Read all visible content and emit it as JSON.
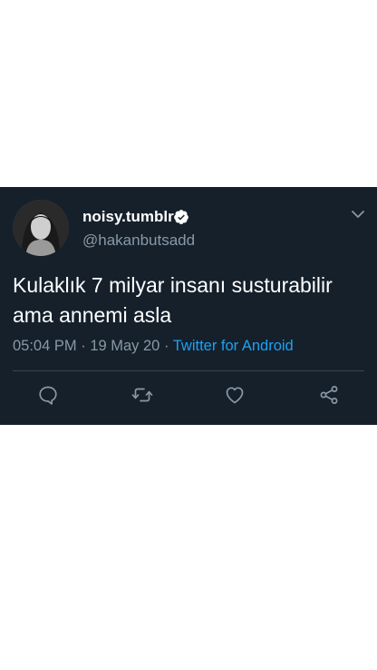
{
  "tweet": {
    "display_name": "noisy.tumblr",
    "handle": "@hakanbutsadd",
    "text": "Kulaklık 7 milyar insanı susturabilir ama annemi asla",
    "time": "05:04 PM",
    "date": "19 May 20",
    "separator": "·",
    "source": "Twitter for Android"
  },
  "icons": {
    "verified": "verified-badge-icon",
    "caret": "chevron-down-icon",
    "reply": "reply-icon",
    "retweet": "retweet-icon",
    "like": "heart-icon",
    "share": "share-icon"
  },
  "colors": {
    "card_background": "#15202b",
    "primary_text": "#ffffff",
    "secondary_text": "#8899a6",
    "link": "#1da1f2",
    "icon": "#8899a6"
  }
}
